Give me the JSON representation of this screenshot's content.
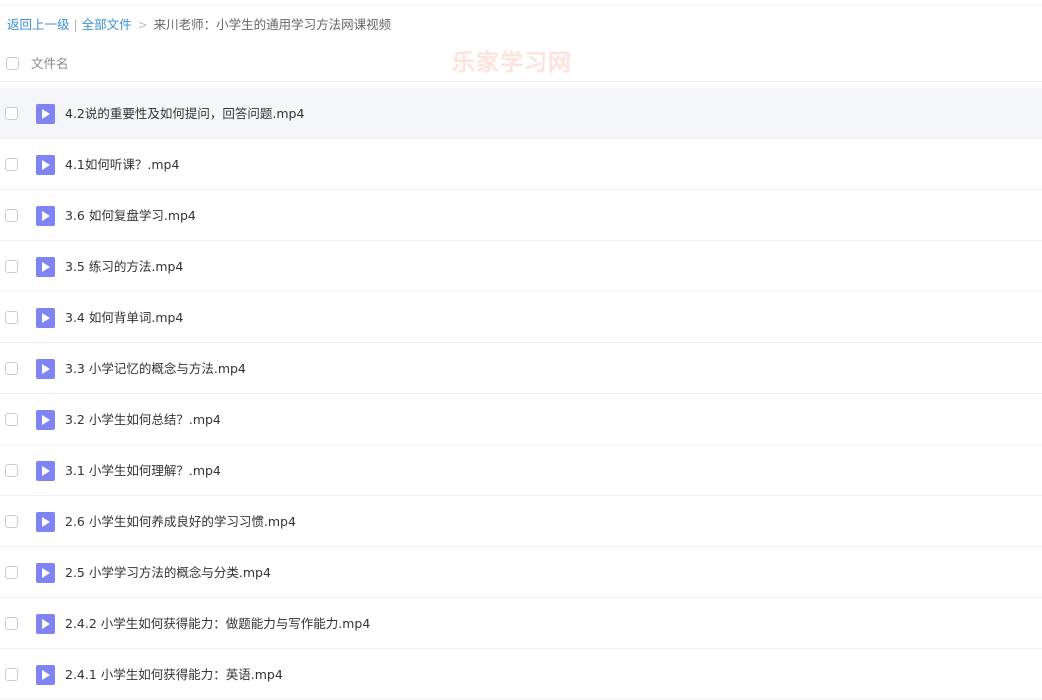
{
  "breadcrumb": {
    "back": "返回上一级",
    "separator_bar": "|",
    "all_files": "全部文件",
    "separator_gt": ">",
    "current": "来川老师：小学生的通用学习方法网课视频"
  },
  "header": {
    "column_label": "文件名"
  },
  "watermark": "乐家学习网",
  "files": [
    "4.2说的重要性及如何提问，回答问题.mp4",
    "4.1如何听课？.mp4",
    "3.6 如何复盘学习.mp4",
    "3.5 练习的方法.mp4",
    "3.4 如何背单词.mp4",
    "3.3 小学记忆的概念与方法.mp4",
    "3.2 小学生如何总结？.mp4",
    "3.1 小学生如何理解？.mp4",
    "2.6 小学生如何养成良好的学习习惯.mp4",
    "2.5 小学学习方法的概念与分类.mp4",
    "2.4.2 小学生如何获得能力：做题能力与写作能力.mp4",
    "2.4.1 小学生如何获得能力：英语.mp4"
  ],
  "colors": {
    "link": "#3b8fd9",
    "icon": "#7f84f4",
    "row_highlight": "#f5f6fa"
  },
  "icons": {
    "file_type": "video-file-icon"
  }
}
